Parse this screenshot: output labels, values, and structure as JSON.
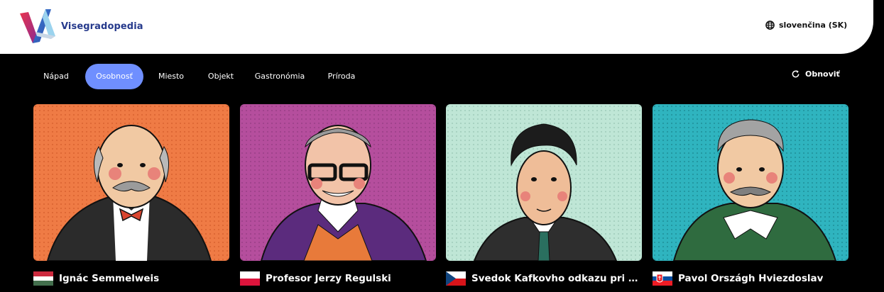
{
  "header": {
    "site_name": "Visegradopedia",
    "language": "slovenčina (SK)",
    "logo_icon": "visegrad-v-logo",
    "language_icon": "globe-icon"
  },
  "nav": {
    "tabs": [
      {
        "label": "Nápad",
        "active": false
      },
      {
        "label": "Osobnosť",
        "active": true
      },
      {
        "label": "Miesto",
        "active": false
      },
      {
        "label": "Objekt",
        "active": false
      },
      {
        "label": "Gastronómia",
        "active": false
      },
      {
        "label": "Príroda",
        "active": false
      }
    ],
    "refresh_label": "Obnoviť",
    "refresh_icon": "refresh-icon"
  },
  "cards": [
    {
      "title": "Ignác Semmelweis",
      "flag": "hungary-flag",
      "bg": "#ef7b45"
    },
    {
      "title": "Profesor Jerzy Regulski",
      "flag": "poland-flag",
      "bg": "#b54e9d"
    },
    {
      "title": "Svedok Kafkovho odkazu pri Špan...",
      "flag": "czech-flag",
      "bg": "#bfe6d6"
    },
    {
      "title": "Pavol Országh Hviezdoslav",
      "flag": "slovakia-flag",
      "bg": "#2fb4bf"
    }
  ],
  "colors": {
    "accent": "#6f8fff",
    "brand_text": "#263a8c",
    "background": "#000000"
  }
}
